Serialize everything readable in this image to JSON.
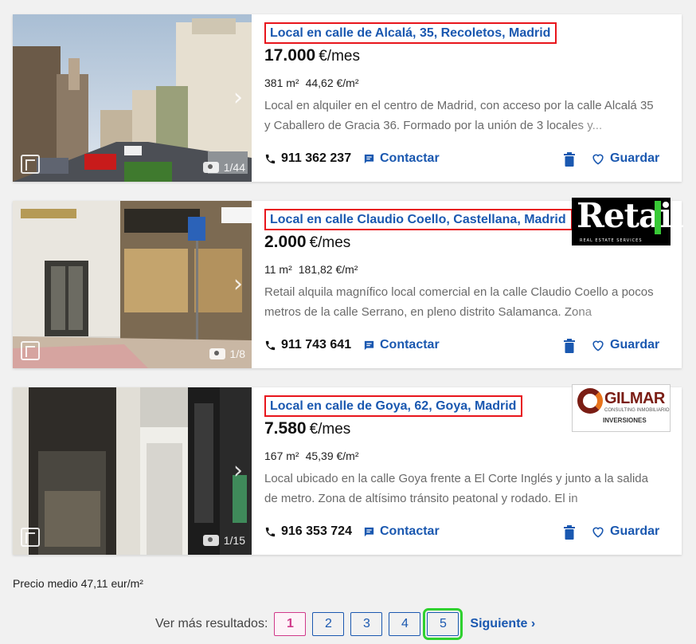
{
  "listings": [
    {
      "title": "Local en calle de Alcalá, 35, Recoletos, Madrid",
      "price": "17.000",
      "price_unit": "€/mes",
      "area": "381 m²",
      "price_per_m2": "44,62 €/m²",
      "description": "Local en alquiler en el centro de Madrid, con acceso por la calle Alcalá 35 y Caballero de Gracia 36. Formado por la unión de 3 locales y...",
      "phone": "911 362 237",
      "contact_label": "Contactar",
      "save_label": "Guardar",
      "photo_counter": "1/44"
    },
    {
      "title": "Local en calle Claudio Coello, Castellana, Madrid",
      "price": "2.000",
      "price_unit": "€/mes",
      "area": "11 m²",
      "price_per_m2": "181,82 €/m²",
      "description": "Retail alquila magnífico local comercial en la calle Claudio Coello a pocos metros de la calle Serrano, en pleno distrito Salamanca. Zona",
      "phone": "911 743 641",
      "contact_label": "Contactar",
      "save_label": "Guardar",
      "photo_counter": "1/8",
      "logo": {
        "word": "Retail",
        "sub": "REAL ESTATE SERVICES"
      }
    },
    {
      "title": "Local en calle de Goya, 62, Goya, Madrid",
      "price": "7.580",
      "price_unit": "€/mes",
      "area": "167 m²",
      "price_per_m2": "45,39 €/m²",
      "description": "Local ubicado en la calle Goya frente a El Corte Inglés y junto a la salida de metro. Zona de altísimo tránsito peatonal y rodado. El in",
      "phone": "916 353 724",
      "contact_label": "Contactar",
      "save_label": "Guardar",
      "photo_counter": "1/15",
      "logo": {
        "name": "GILMAR",
        "sub1": "CONSULTING INMOBILIARIO",
        "sub2": "INVERSIONES"
      }
    }
  ],
  "average_price": "Precio medio 47,11 eur/m²",
  "pagination": {
    "label": "Ver más resultados:",
    "pages": [
      "1",
      "2",
      "3",
      "4",
      "5"
    ],
    "current": "1",
    "next_label": "Siguiente"
  },
  "colors": {
    "link": "#1a58b0",
    "highlight_red": "#e8151c",
    "highlight_green": "#2fd12f",
    "current_page": "#d0398a"
  },
  "icons": {
    "phone": "phone-icon",
    "contact": "chat-icon",
    "trash": "trash-icon",
    "save": "heart-icon",
    "next": "chevron-right-icon",
    "camera": "camera-icon",
    "arrow": "chevron-right-icon"
  }
}
